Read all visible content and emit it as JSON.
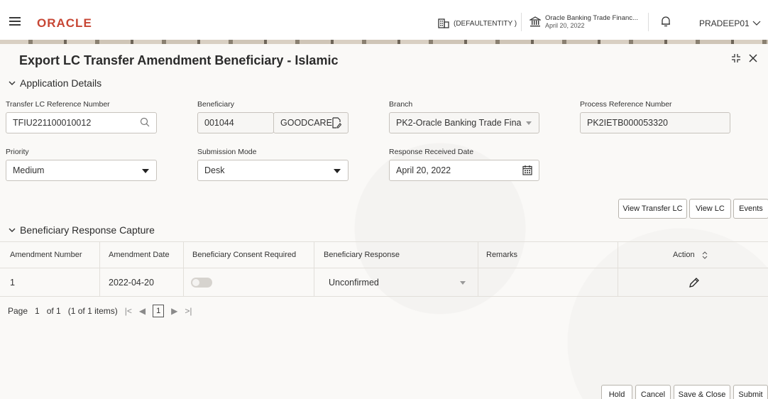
{
  "header": {
    "logo": "ORACLE",
    "entity": "(DEFAULTENTITY )",
    "bank_name": "Oracle Banking Trade Financ...",
    "bank_date": "April 20, 2022",
    "user": "PRADEEP01"
  },
  "page": {
    "title": "Export LC Transfer Amendment Beneficiary - Islamic"
  },
  "application_details": {
    "heading": "Application Details",
    "transfer_ref_label": "Transfer LC Reference Number",
    "transfer_ref_value": "TFIU221100010012",
    "beneficiary_label": "Beneficiary",
    "beneficiary_id": "001044",
    "beneficiary_name": "GOODCARE",
    "branch_label": "Branch",
    "branch_value": "PK2-Oracle Banking Trade Fina",
    "process_ref_label": "Process Reference Number",
    "process_ref_value": "PK2IETB000053320",
    "priority_label": "Priority",
    "priority_value": "Medium",
    "submission_label": "Submission Mode",
    "submission_value": "Desk",
    "response_date_label": "Response Received Date",
    "response_date_value": "April 20, 2022"
  },
  "action_buttons": {
    "view_transfer_lc": "View Transfer LC",
    "view_lc": "View LC",
    "events": "Events"
  },
  "response_capture": {
    "heading": "Beneficiary Response Capture",
    "columns": [
      "Amendment Number",
      "Amendment Date",
      "Beneficiary Consent Required",
      "Beneficiary Response",
      "Remarks",
      "Action"
    ],
    "rows": [
      {
        "amendment_number": "1",
        "amendment_date": "2022-04-20",
        "consent_required": false,
        "response": "Unconfirmed",
        "remarks": ""
      }
    ]
  },
  "pagination": {
    "page_label": "Page",
    "page": "1",
    "of_label": "of 1",
    "items": "(1 of 1 items)",
    "current": "1"
  },
  "footer": {
    "hold": "Hold",
    "cancel": "Cancel",
    "save_close": "Save & Close",
    "submit": "Submit"
  }
}
